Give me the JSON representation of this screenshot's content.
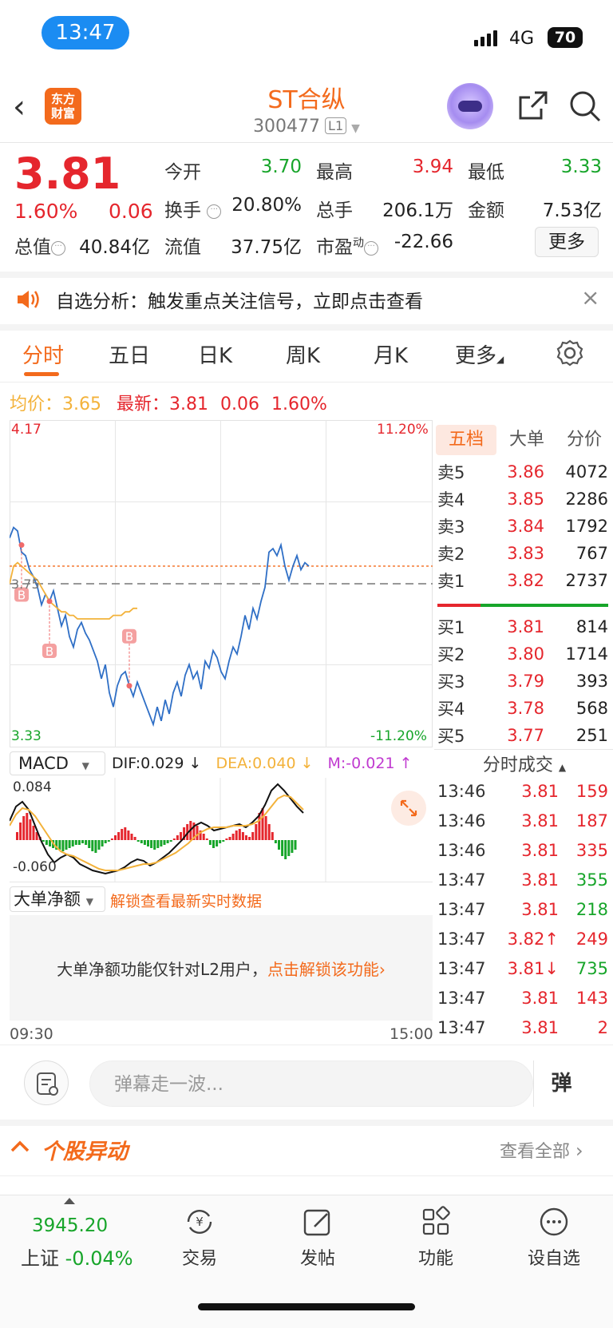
{
  "status_bar": {
    "time": "13:47",
    "network": "4G",
    "battery": "70"
  },
  "header": {
    "logo_text": "东方\n财富",
    "stock_name": "ST合纵",
    "stock_code": "300477",
    "level": "L1"
  },
  "quote": {
    "price": "3.81",
    "change_pct": "1.60%",
    "change": "0.06",
    "open_label": "今开",
    "open": "3.70",
    "high_label": "最高",
    "high": "3.94",
    "low_label": "最低",
    "low": "3.33",
    "turnover_label": "换手",
    "turnover": "20.80%",
    "volume_label": "总手",
    "volume": "206.1万",
    "amount_label": "金额",
    "amount": "7.53亿",
    "mktcap_label": "总值",
    "mktcap": "40.84亿",
    "float_label": "流值",
    "float_cap": "37.75亿",
    "pe_label": "市盈",
    "pe_sup": "动",
    "pe": "-22.66",
    "more_label": "更多"
  },
  "alert": {
    "text": "自选分析：触发重点关注信号，立即点击查看"
  },
  "tabs": [
    "分时",
    "五日",
    "日K",
    "周K",
    "月K",
    "更多"
  ],
  "avg_row": {
    "avg_label": "均价：",
    "avg": "3.65",
    "latest_label": "最新：",
    "latest": "3.81",
    "chg": "0.06",
    "pct": "1.60%"
  },
  "chart_labels": {
    "top_price": "4.17",
    "top_pct": "11.20%",
    "bottom_price": "3.33",
    "bottom_pct": "-11.20%",
    "mid_price": "3.75",
    "buy_marker": "B"
  },
  "chart_data": {
    "type": "line",
    "ylim": [
      3.33,
      4.17
    ],
    "prev_close": 3.75,
    "series": [
      {
        "values": [
          3.88,
          3.91,
          3.9,
          3.84,
          3.83,
          3.79,
          3.77,
          3.74,
          3.69,
          3.72,
          3.7,
          3.73,
          3.68,
          3.63,
          3.66,
          3.6,
          3.57,
          3.62,
          3.64,
          3.61,
          3.59,
          3.56,
          3.53,
          3.48,
          3.52,
          3.44,
          3.4,
          3.46,
          3.49,
          3.5,
          3.46,
          3.43,
          3.47,
          3.44,
          3.41,
          3.38,
          3.35,
          3.4,
          3.36,
          3.42,
          3.38,
          3.44,
          3.47,
          3.43,
          3.49,
          3.52,
          3.48,
          3.5,
          3.45,
          3.53,
          3.51,
          3.56,
          3.54,
          3.5,
          3.48,
          3.53,
          3.57,
          3.55,
          3.6,
          3.66,
          3.62,
          3.68,
          3.65,
          3.7,
          3.74,
          3.84,
          3.85,
          3.83,
          3.86,
          3.8,
          3.76,
          3.8,
          3.83,
          3.79,
          3.81,
          3.8
        ]
      },
      {
        "values": [
          3.75,
          3.8,
          3.81,
          3.8,
          3.79,
          3.78,
          3.77,
          3.76,
          3.74,
          3.72,
          3.7,
          3.69,
          3.68,
          3.67,
          3.67,
          3.66,
          3.66,
          3.65,
          3.65,
          3.65,
          3.65,
          3.65,
          3.65,
          3.65,
          3.65,
          3.65,
          3.66,
          3.66,
          3.66,
          3.67,
          3.67,
          3.68,
          3.68
        ]
      }
    ]
  },
  "order_book": {
    "tabs": [
      "五档",
      "大单",
      "分价"
    ],
    "asks": [
      {
        "label": "卖5",
        "price": "3.86",
        "vol": "4072"
      },
      {
        "label": "卖4",
        "price": "3.85",
        "vol": "2286"
      },
      {
        "label": "卖3",
        "price": "3.84",
        "vol": "1792"
      },
      {
        "label": "卖2",
        "price": "3.83",
        "vol": "767"
      },
      {
        "label": "卖1",
        "price": "3.82",
        "vol": "2737"
      }
    ],
    "bids": [
      {
        "label": "买1",
        "price": "3.81",
        "vol": "814"
      },
      {
        "label": "买2",
        "price": "3.80",
        "vol": "1714"
      },
      {
        "label": "买3",
        "price": "3.79",
        "vol": "393"
      },
      {
        "label": "买4",
        "price": "3.78",
        "vol": "568"
      },
      {
        "label": "买5",
        "price": "3.77",
        "vol": "251"
      }
    ]
  },
  "ticks": {
    "header": "分时成交",
    "rows": [
      {
        "time": "13:46",
        "price": "3.81",
        "vol": "159",
        "dir": "up"
      },
      {
        "time": "13:46",
        "price": "3.81",
        "vol": "187",
        "dir": "up"
      },
      {
        "time": "13:46",
        "price": "3.81",
        "vol": "335",
        "dir": "up"
      },
      {
        "time": "13:47",
        "price": "3.81",
        "vol": "355",
        "dir": "down"
      },
      {
        "time": "13:47",
        "price": "3.81",
        "vol": "218",
        "dir": "down"
      },
      {
        "time": "13:47",
        "price": "3.82↑",
        "vol": "249",
        "dir": "up"
      },
      {
        "time": "13:47",
        "price": "3.81↓",
        "vol": "735",
        "dir": "down"
      },
      {
        "time": "13:47",
        "price": "3.81",
        "vol": "143",
        "dir": "up"
      },
      {
        "time": "13:47",
        "price": "3.81",
        "vol": "2",
        "dir": "up"
      }
    ]
  },
  "macd": {
    "select": "MACD",
    "dif": "DIF:0.029 ↓",
    "dea": "DEA:0.040 ↓",
    "m": "M:-0.021 ↑",
    "top": "0.084",
    "bottom": "-0.060"
  },
  "big_net": {
    "select": "大单净额",
    "unlock_link": "解锁查看最新实时数据",
    "msg": "大单净额功能仅针对L2用户，",
    "msg_link": "点击解锁该功能›"
  },
  "time_axis": {
    "start": "09:30",
    "end": "15:00"
  },
  "danmaku": {
    "placeholder": "弹幕走一波...",
    "button": "弹"
  },
  "stock_moves": {
    "title": "个股异动",
    "view_all": "查看全部"
  },
  "bottom_nav": {
    "index_value": "3945.20",
    "index_name": "上证",
    "index_pct": "-0.04%",
    "items": [
      {
        "label": "交易",
        "icon": "trade-icon"
      },
      {
        "label": "发帖",
        "icon": "post-icon"
      },
      {
        "label": "功能",
        "icon": "apps-icon"
      },
      {
        "label": "设自选",
        "icon": "add-watchlist-icon"
      }
    ]
  },
  "colors": {
    "up": "#e5262d",
    "down": "#17a52a",
    "accent": "#f36a1c",
    "price_line": "#2f6fc6",
    "avg_line": "#f3b23a"
  }
}
